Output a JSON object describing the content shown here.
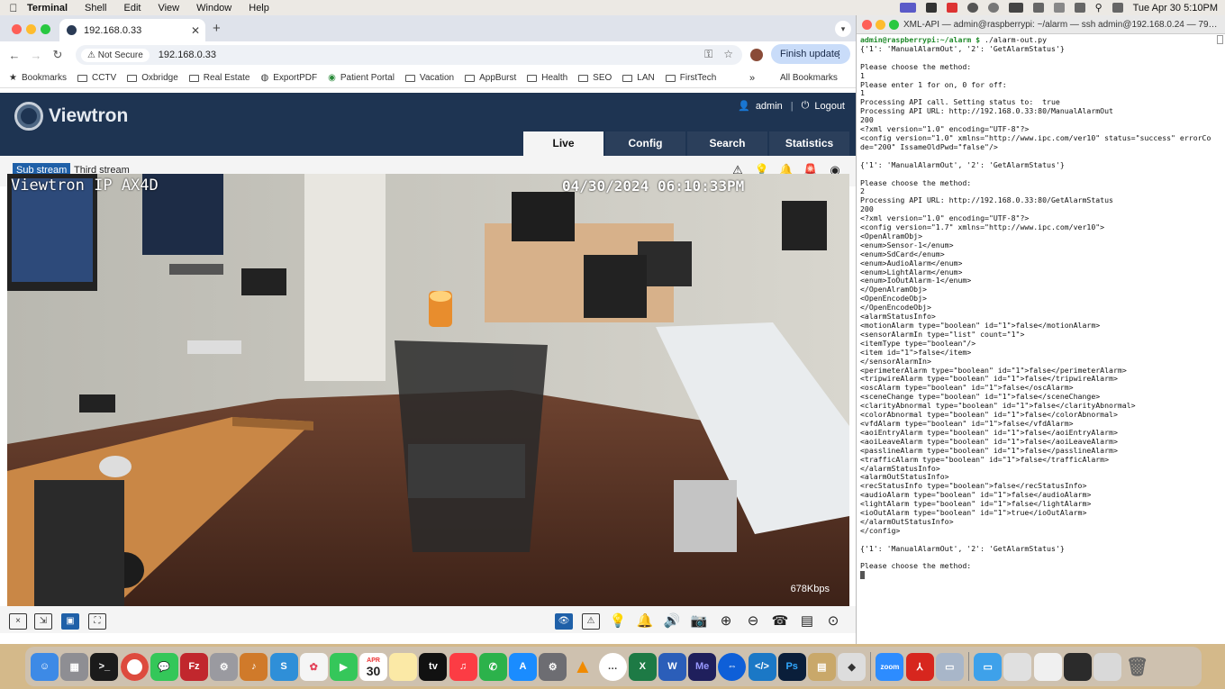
{
  "menubar": {
    "app_name": "Terminal",
    "items": [
      "Shell",
      "Edit",
      "View",
      "Window",
      "Help"
    ],
    "clock": "Tue Apr 30  5:10PM"
  },
  "browser": {
    "tab_title": "192.168.0.33",
    "not_secure": "Not Secure",
    "url": "192.168.0.33",
    "finish_update": "Finish update",
    "bookmarks": [
      "Bookmarks",
      "CCTV",
      "Oxbridge",
      "Real Estate",
      "ExportPDF",
      "Patient Portal",
      "Vacation",
      "AppBurst",
      "Health",
      "SEO",
      "LAN",
      "FirstTech"
    ],
    "more": "»",
    "all_bookmarks": "All Bookmarks"
  },
  "viewtron": {
    "logo": "Viewtron",
    "user": "admin",
    "logout": "Logout",
    "tabs": [
      "Live",
      "Config",
      "Search",
      "Statistics"
    ],
    "streams": [
      "Sub stream",
      "Third stream"
    ],
    "osd_name": "Viewtron IP AX4D",
    "osd_time": "04/30/2024  06:10:33PM",
    "bitrate": "678Kbps"
  },
  "terminal": {
    "title": "XML-API — admin@raspberrypi: ~/alarm — ssh admin@192.168.0.24 — 79…",
    "prompt": "admin@raspberrypi:~/alarm $",
    "command": " ./alarm-out.py",
    "output": "{'1': 'ManualAlarmOut', '2': 'GetAlarmStatus'}\n\nPlease choose the method:\n1\nPlease enter 1 for on, 0 for off:\n1\nProcessing API call. Setting status to:  true\nProcessing API URL: http://192.168.0.33:80/ManualAlarmOut\n200\n<?xml version=\"1.0\" encoding=\"UTF-8\"?>\n<config version=\"1.0\" xmlns=\"http://www.ipc.com/ver10\" status=\"success\" errorCo\nde=\"200\" IssameOldPwd=\"false\"/>\n\n{'1': 'ManualAlarmOut', '2': 'GetAlarmStatus'}\n\nPlease choose the method:\n2\nProcessing API URL: http://192.168.0.33:80/GetAlarmStatus\n200\n<?xml version=\"1.0\" encoding=\"UTF-8\"?>\n<config version=\"1.7\" xmlns=\"http://www.ipc.com/ver10\">\n<OpenAlramObj>\n<enum>Sensor-1</enum>\n<enum>SdCard</enum>\n<enum>AudioAlarm</enum>\n<enum>LightAlarm</enum>\n<enum>IoOutAlarm-1</enum>\n</OpenAlramObj>\n<OpenEncodeObj>\n</OpenEncodeObj>\n<alarmStatusInfo>\n<motionAlarm type=\"boolean\" id=\"1\">false</motionAlarm>\n<sensorAlarmIn type=\"list\" count=\"1\">\n<itemType type=\"boolean\"/>\n<item id=\"1\">false</item>\n</sensorAlarmIn>\n<perimeterAlarm type=\"boolean\" id=\"1\">false</perimeterAlarm>\n<tripwireAlarm type=\"boolean\" id=\"1\">false</tripwireAlarm>\n<oscAlarm type=\"boolean\" id=\"1\">false</oscAlarm>\n<sceneChange type=\"boolean\" id=\"1\">false</sceneChange>\n<clarityAbnormal type=\"boolean\" id=\"1\">false</clarityAbnormal>\n<colorAbnormal type=\"boolean\" id=\"1\">false</colorAbnormal>\n<vfdAlarm type=\"boolean\" id=\"1\">false</vfdAlarm>\n<aoiEntryAlarm type=\"boolean\" id=\"1\">false</aoiEntryAlarm>\n<aoiLeaveAlarm type=\"boolean\" id=\"1\">false</aoiLeaveAlarm>\n<passlineAlarm type=\"boolean\" id=\"1\">false</passlineAlarm>\n<trafficAlarm type=\"boolean\" id=\"1\">false</trafficAlarm>\n</alarmStatusInfo>\n<alarmOutStatusInfo>\n<recStatusInfo type=\"boolean\">false</recStatusInfo>\n<audioAlarm type=\"boolean\" id=\"1\">false</audioAlarm>\n<lightAlarm type=\"boolean\" id=\"1\">false</lightAlarm>\n<ioOutAlarm type=\"boolean\" id=\"1\">true</ioOutAlarm>\n</alarmOutStatusInfo>\n</config>\n\n{'1': 'ManualAlarmOut', '2': 'GetAlarmStatus'}\n\nPlease choose the method:"
  },
  "dock": {
    "calendar_month": "APR",
    "calendar_day": "30",
    "apps": [
      "finder-icon",
      "launchpad-icon",
      "terminal-icon",
      "chrome-icon",
      "messages-icon",
      "filezilla-icon",
      "settings-icon",
      "garageband-icon",
      "s-app-icon",
      "photos-icon",
      "facetime-icon",
      "calendar-icon",
      "notes-icon",
      "appletv-icon",
      "music-icon",
      "phone-icon",
      "appstore-icon",
      "system-prefs-icon",
      "vlc-icon",
      "chat-icon",
      "excel-icon",
      "word-icon",
      "media-encoder-icon",
      "teamviewer-icon",
      "vscode-icon",
      "photoshop-icon",
      "archive-icon",
      "roblox-icon",
      "zoom-icon",
      "acrobat-icon",
      "preview-icon",
      "folder-icon",
      "screenshot-icon",
      "trash-icon"
    ],
    "zoom_label": "zoom"
  }
}
